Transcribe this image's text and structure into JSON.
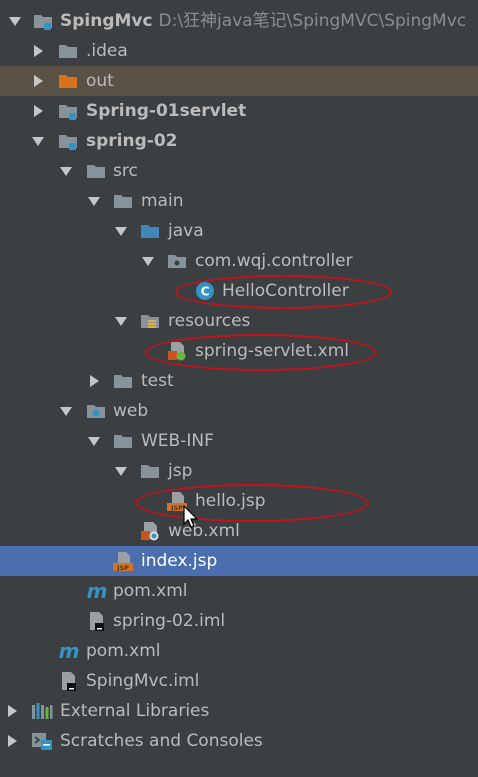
{
  "tree": {
    "project": {
      "name": "SpingMvc",
      "path": "D:\\狂神java笔记\\SpingMVC\\SpingMvc"
    },
    "idea": "idea",
    "out": "out",
    "spring01": "Spring-01servlet",
    "spring02": "spring-02",
    "src": "src",
    "main": "main",
    "java": "java",
    "package": "com.wqj.controller",
    "hello_controller": "HelloController",
    "resources": "resources",
    "spring_servlet": "spring-servlet.xml",
    "test": "test",
    "web": "web",
    "webinf": "WEB-INF",
    "jsp": "jsp",
    "hello_jsp": "hello.jsp",
    "web_xml": "web.xml",
    "index_jsp": "index.jsp",
    "pom_inner": "pom.xml",
    "iml_inner": "spring-02.iml",
    "pom_outer": "pom.xml",
    "iml_outer": "SpingMvc.iml",
    "external": "External Libraries",
    "scratches": "Scratches and Consoles"
  },
  "colors": {
    "background": "#3c3f41",
    "selection": "#4b6eaf",
    "excluded_row": "#5a5147",
    "annotation": "#c8101a"
  }
}
